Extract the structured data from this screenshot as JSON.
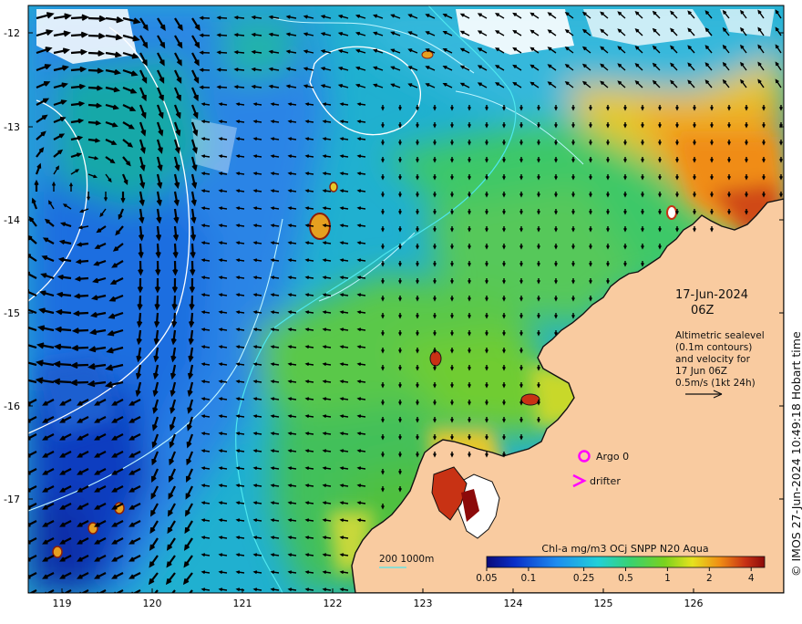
{
  "map": {
    "date_line1": "17-Jun-2024",
    "date_line2": "06Z",
    "info_lines": [
      "Altimetric sealevel",
      "(0.1m contours)",
      "and velocity for",
      "17 Jun 06Z",
      "0.5m/s (1kt 24h)"
    ],
    "argo_label": "Argo 0",
    "drifter_label": "drifter",
    "bathy_label": "200  1000m",
    "copyright": "© IMOS 27-Jun-2024 10:49:18 Hobart time",
    "lat_ticks": [
      "-12",
      "-13",
      "-14",
      "-15",
      "-16",
      "-17"
    ],
    "lon_ticks": [
      "119",
      "120",
      "121",
      "122",
      "123",
      "124",
      "125",
      "126"
    ],
    "colorbar": {
      "title": "Chl-a mg/m3 OCj SNPP N20 Aqua",
      "tick_labels": [
        "0.05",
        "0.1",
        "0.25",
        "0.5",
        "1",
        "2",
        "4"
      ],
      "tick_values": [
        0.05,
        0.1,
        0.25,
        0.5,
        1,
        2,
        4
      ],
      "range": [
        0.05,
        5
      ]
    },
    "colors": {
      "land": "#f9cba0",
      "deep_blue": "#0a2f9e",
      "argo": "#ff00ff",
      "drifter": "#ff00ff",
      "contour": "#bff5ff",
      "isobath_200": "#4ee6ee"
    }
  }
}
